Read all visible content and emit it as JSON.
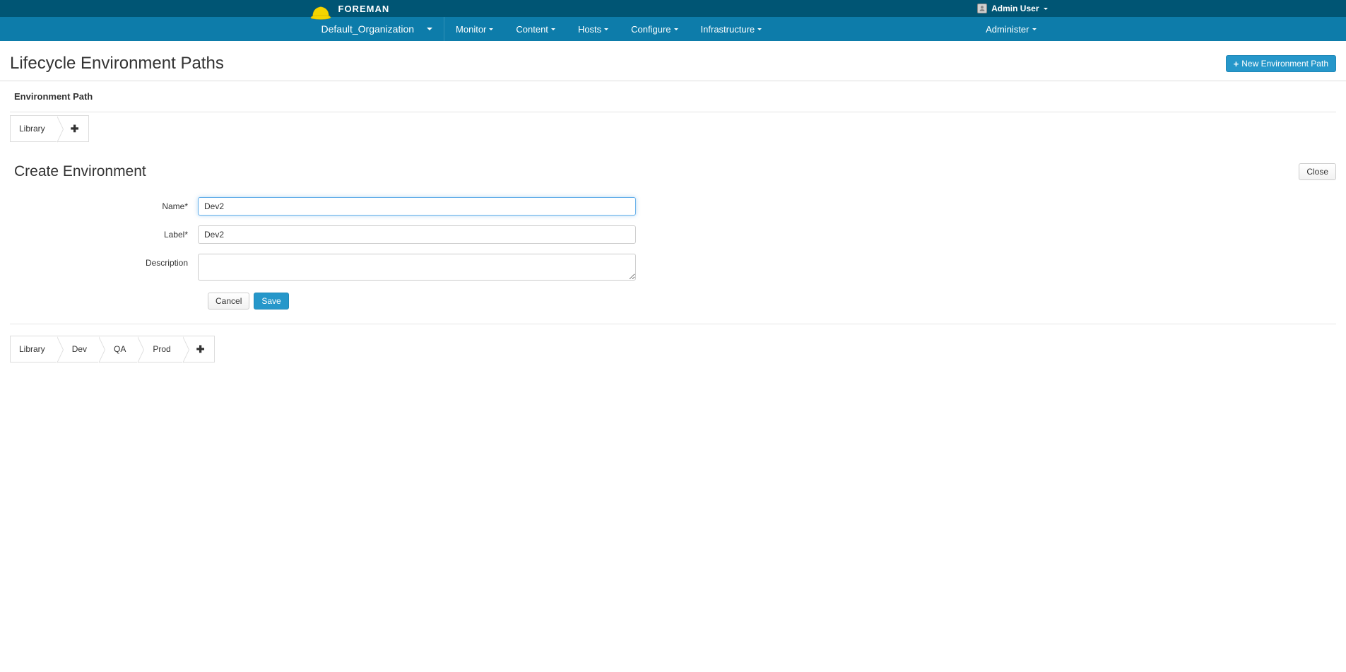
{
  "brand": {
    "name": "FOREMAN"
  },
  "user": {
    "display_name": "Admin User"
  },
  "org": {
    "name": "Default_Organization"
  },
  "nav": {
    "monitor": "Monitor",
    "content": "Content",
    "hosts": "Hosts",
    "configure": "Configure",
    "infrastructure": "Infrastructure",
    "administer": "Administer"
  },
  "page": {
    "title": "Lifecycle Environment Paths",
    "new_button": "New Environment Path",
    "section_label": "Environment Path"
  },
  "path1": {
    "items": [
      "Library"
    ]
  },
  "form": {
    "title": "Create Environment",
    "close": "Close",
    "name_label": "Name*",
    "label_label": "Label*",
    "description_label": "Description",
    "name_value": "Dev2",
    "label_value": "Dev2",
    "description_value": "",
    "cancel": "Cancel",
    "save": "Save"
  },
  "path2": {
    "items": [
      "Library",
      "Dev",
      "QA",
      "Prod"
    ]
  }
}
